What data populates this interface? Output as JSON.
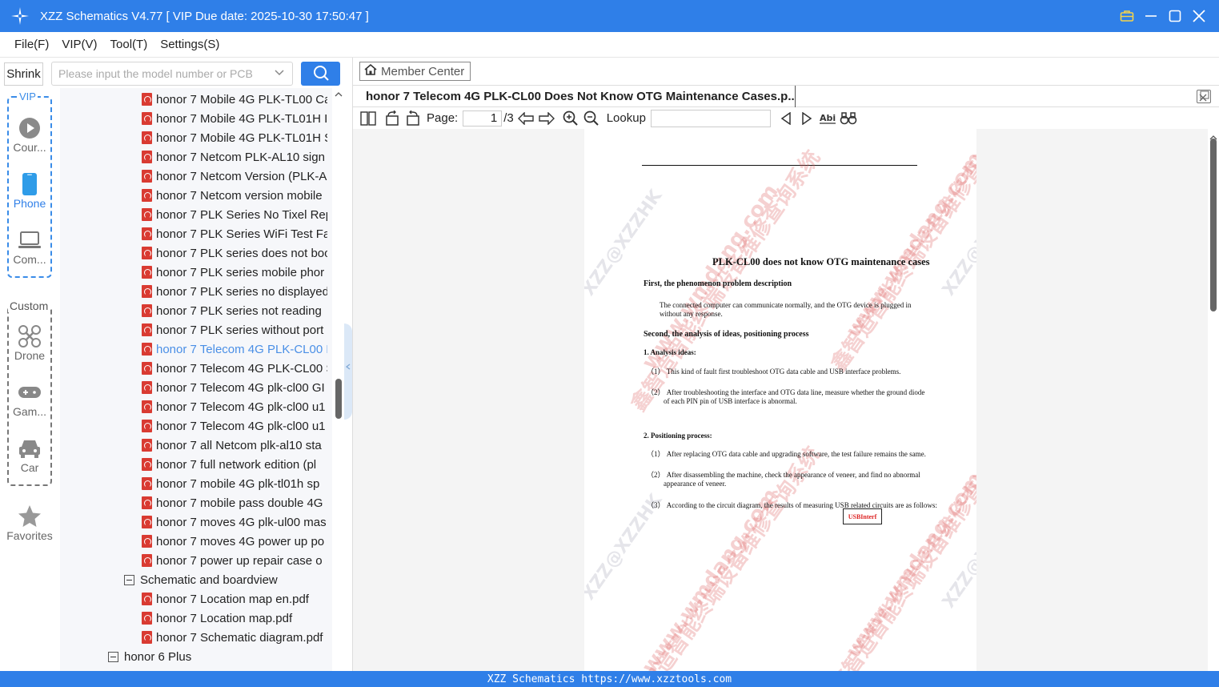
{
  "window": {
    "title": "XZZ Schematics V4.77 [ VIP Due date: 2025-10-30 17:50:47 ]"
  },
  "menu": [
    "File(F)",
    "VIP(V)",
    "Tool(T)",
    "Settings(S)"
  ],
  "search": {
    "shrink_label": "Shrink",
    "placeholder": "Please input the model number or PCB"
  },
  "categories": {
    "vip_label": "VIP",
    "custom_label": "Custom",
    "items": [
      {
        "label": "Cour...",
        "icon": "play-circle-icon"
      },
      {
        "label": "Phone",
        "icon": "phone-icon"
      },
      {
        "label": "Com...",
        "icon": "laptop-icon"
      },
      {
        "label": "Drone",
        "icon": "drone-icon"
      },
      {
        "label": "Gam...",
        "icon": "gamepad-icon"
      },
      {
        "label": "Car",
        "icon": "car-icon"
      },
      {
        "label": "Favorites",
        "icon": "star-icon"
      }
    ]
  },
  "tree": {
    "files": [
      "honor 7 Mobile 4G PLK-TL00 Ca",
      "honor 7 Mobile 4G PLK-TL01H I",
      "honor 7 Mobile 4G PLK-TL01H S",
      "honor 7 Netcom PLK-AL10 sign",
      "honor 7 Netcom Version (PLK-A",
      "honor 7 Netcom version mobile",
      "honor 7 PLK Series No Tixel Rep",
      "honor 7 PLK Series WiFi Test Fai",
      "honor 7 PLK series does not boo",
      "honor 7 PLK series mobile phor",
      "honor 7 PLK series no displayed",
      "honor 7 PLK series not reading",
      "honor 7 PLK series without port",
      "honor 7 Telecom 4G PLK-CL00 D",
      "honor 7 Telecom 4G PLK-CL00 S",
      "honor 7 Telecom 4G plk-cl00 GI",
      "honor 7 Telecom 4G plk-cl00 u1",
      "honor 7 Telecom 4G plk-cl00 u1",
      "honor 7 all Netcom plk-al10 sta",
      "honor 7 full network edition (pl",
      "honor 7 mobile 4G plk-tl01h sp",
      "honor 7 mobile pass double 4G",
      "honor 7 moves 4G plk-ul00 mas",
      "honor 7 moves 4G power up po",
      "honor 7 power up repair case o"
    ],
    "folder": "Schematic and boardview",
    "folder_files": [
      "honor 7 Location map en.pdf",
      "honor 7 Location map.pdf",
      "honor 7 Schematic diagram.pdf"
    ],
    "parent": "honor 6 Plus"
  },
  "viewer": {
    "member_center": "Member Center",
    "doc_tab": "honor 7 Telecom 4G PLK-CL00 Does Not Know OTG Maintenance Cases.p...",
    "page_label": "Page:",
    "page_current": "1",
    "page_total": "/3",
    "lookup_label": "Lookup",
    "lookup_value": ""
  },
  "document": {
    "title": "PLK-CL00 does not know OTG maintenance cases",
    "h1": "First, the phenomenon problem description",
    "p1a": "The connected computer can communicate normally, and the OTG device is plugged in",
    "p1b": "without any response.",
    "h2": "Second, the analysis of ideas, positioning process",
    "h3": "1. Analysis ideas:",
    "a1": "（1） This kind of fault first troubleshoot OTG data cable and USB interface problems.",
    "a2a": "（2） After troubleshooting the interface and OTG data line, measure whether the ground diode",
    "a2b": "of each PIN pin of USB interface is abnormal.",
    "h4": "2. Positioning process:",
    "b1": "（1） After replacing OTG data cable and upgrading software, the test failure remains the same.",
    "b2a": "（2） After disassembling the machine, check the appearance of veneer, and find no abnormal",
    "b2b": "appearance of veneer.",
    "b3": "（3） According to the circuit diagram, the results of measuring USB related circuits are as follows:",
    "usb_label": "USBInterf",
    "watermark_cn": "鑫智造智能终端设备维修查询系统",
    "watermark_url": "www.wmdang.com",
    "watermark_tag": "XZZ@XZZHK"
  },
  "status": {
    "text": "XZZ Schematics https://www.xzztools.com"
  },
  "colors": {
    "brand": "#2f7fe8",
    "active_tree": "#4a8fe6",
    "pdf_icon": "#d93b32"
  }
}
